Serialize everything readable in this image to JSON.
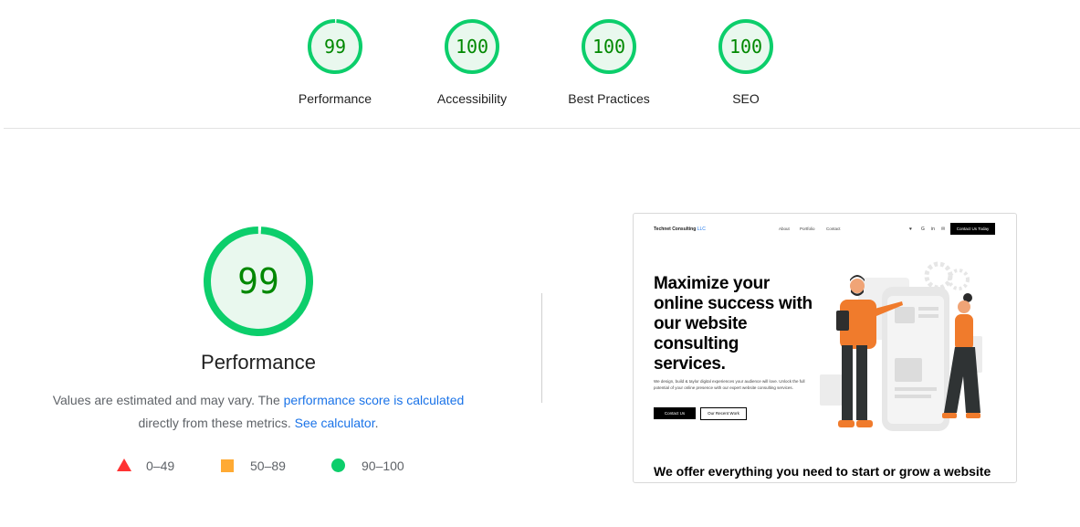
{
  "scores": [
    {
      "value": "99",
      "label": "Performance",
      "fraction": 0.99
    },
    {
      "value": "100",
      "label": "Accessibility",
      "fraction": 1.0
    },
    {
      "value": "100",
      "label": "Best Practices",
      "fraction": 1.0
    },
    {
      "value": "100",
      "label": "SEO",
      "fraction": 1.0
    }
  ],
  "colors": {
    "pass": "#0cce6b",
    "pass_text": "#008800",
    "average": "#ffaa33",
    "fail": "#ff3333",
    "link": "#1a73e8"
  },
  "performance": {
    "score": "99",
    "fraction": 0.99,
    "title": "Performance",
    "desc_before": "Values are estimated and may vary. The ",
    "desc_link": "performance score is calculated",
    "desc_middle": " directly from these metrics. ",
    "desc_link2": "See calculator",
    "desc_end": "."
  },
  "legend": [
    {
      "icon": "triangle-icon",
      "range": "0–49"
    },
    {
      "icon": "square-icon",
      "range": "50–89"
    },
    {
      "icon": "circle-icon",
      "range": "90–100"
    }
  ],
  "thumbnail": {
    "brand": "Technet Consulting",
    "brand_suffix": "LLC",
    "nav": [
      "About",
      "Portfolio",
      "Contact"
    ],
    "social_icons": [
      "twitter-icon",
      "google-icon",
      "linkedin-icon",
      "mail-icon"
    ],
    "social_glyphs": [
      "♥",
      "G",
      "in",
      "✉"
    ],
    "cta": "Contact Us Today",
    "hero_lines": [
      "Maximize your",
      "online success with",
      "our website",
      "consulting",
      "services."
    ],
    "subtext": "We design, build & taylor digital experiences your audience will love. Unlock the full potential of your online presence with our expert website consulting services.",
    "btn_primary": "Contact Us",
    "btn_secondary": "Our Recent Work",
    "bottom_heading": "We offer everything you need to start or grow a website"
  }
}
